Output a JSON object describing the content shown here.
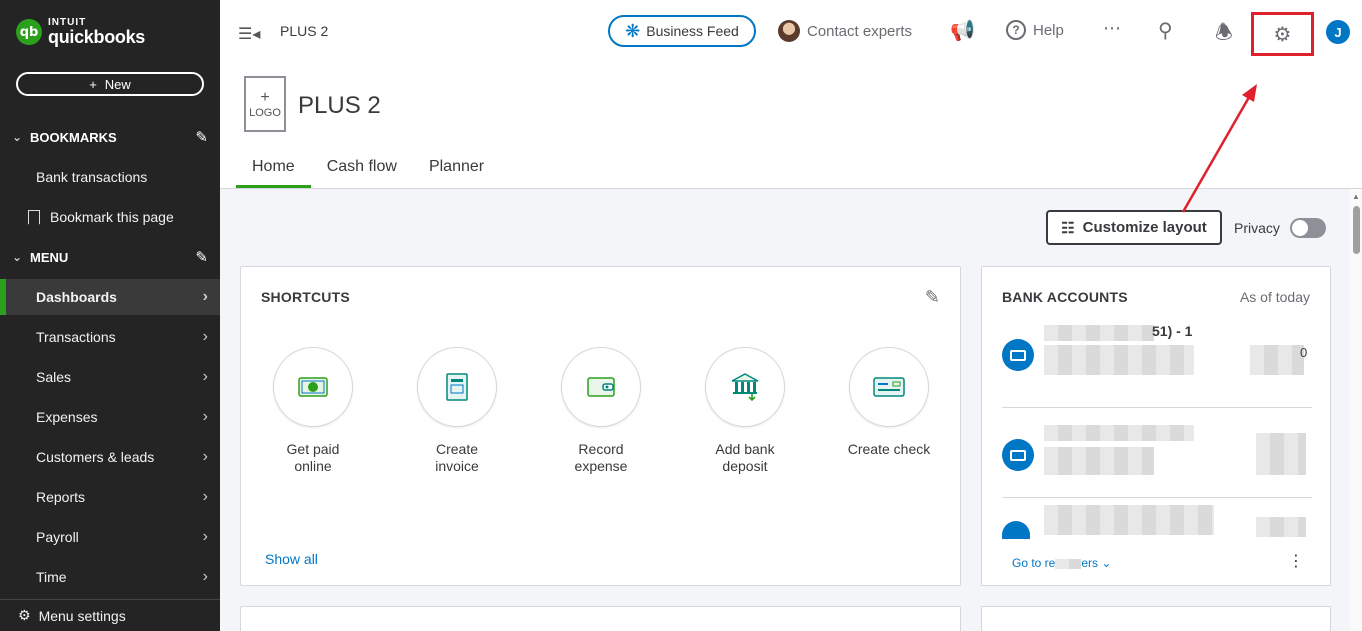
{
  "brand": {
    "intuit": "INTUIT",
    "product": "quickbooks",
    "mark": "qb"
  },
  "sidebar": {
    "new_label": "New",
    "bookmarks_header": "BOOKMARKS",
    "bookmarks": [
      "Bank transactions",
      "Bookmark this page"
    ],
    "menu_header": "MENU",
    "menu_items": [
      {
        "label": "Dashboards",
        "active": true
      },
      {
        "label": "Transactions"
      },
      {
        "label": "Sales"
      },
      {
        "label": "Expenses"
      },
      {
        "label": "Customers & leads"
      },
      {
        "label": "Reports"
      },
      {
        "label": "Payroll"
      },
      {
        "label": "Time"
      }
    ],
    "menu_settings": "Menu settings"
  },
  "topbar": {
    "company": "PLUS 2",
    "business_feed": "Business Feed",
    "contact_experts": "Contact experts",
    "help": "Help",
    "avatar_initial": "J"
  },
  "header": {
    "logo_plus": "+",
    "logo_label": "LOGO",
    "company_title": "PLUS 2",
    "tabs": [
      "Home",
      "Cash flow",
      "Planner"
    ],
    "active_tab": "Home"
  },
  "toolbar": {
    "customize_layout": "Customize layout",
    "privacy": "Privacy"
  },
  "shortcuts": {
    "title": "SHORTCUTS",
    "items": [
      {
        "label1": "Get paid",
        "label2": "online",
        "icon": "cash-icon"
      },
      {
        "label1": "Create",
        "label2": "invoice",
        "icon": "invoice-icon"
      },
      {
        "label1": "Record",
        "label2": "expense",
        "icon": "wallet-icon"
      },
      {
        "label1": "Add bank",
        "label2": "deposit",
        "icon": "bank-deposit-icon"
      },
      {
        "label1": "Create check",
        "label2": "",
        "icon": "check-icon"
      }
    ],
    "show_all": "Show all"
  },
  "bank_accounts": {
    "title": "BANK ACCOUNTS",
    "as_of": "As of today",
    "first_account_visible": "51) - 1",
    "balance_fragment": "0",
    "go_to_registers": "Go to re",
    "go_to_registers_tail": "ers"
  },
  "colors": {
    "accent_green": "#2ca01c",
    "link_blue": "#0077c5",
    "annotation_red": "#e0202a",
    "sidebar_bg": "#242424"
  }
}
